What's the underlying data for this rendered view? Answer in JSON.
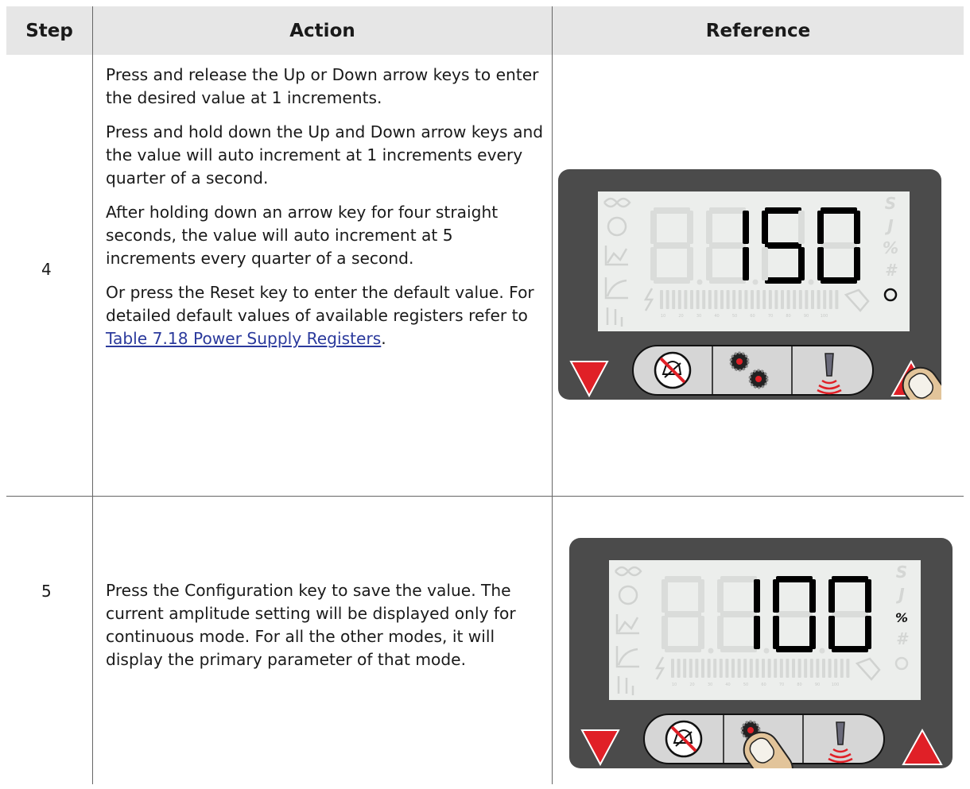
{
  "table": {
    "headers": {
      "step": "Step",
      "action": "Action",
      "reference": "Reference"
    },
    "rows": [
      {
        "step": "4",
        "paragraphs": [
          "Press and release the Up or Down arrow keys to enter the desired value at 1 increments.",
          "Press and hold down the Up and Down arrow keys and the value will auto increment at 1 increments every quarter of a second.",
          "After holding down an arrow key for four straight seconds, the value will auto increment at 5 increments every quarter of a second."
        ],
        "last_paragraph": {
          "text_before": "Or press the Reset key to enter the default value. For detailed default values of available registers refer to ",
          "link_text": "Table 7.18 Power Supply Registers",
          "text_after": "."
        },
        "display": {
          "value": "150",
          "active_unit": "none",
          "indicator": "O",
          "finger_on": "up-arrow-key"
        }
      },
      {
        "step": "5",
        "paragraphs": [
          "Press the Configuration key to save the value. The current amplitude setting will be displayed only for continuous mode. For all the other modes, it will display the primary parameter of that mode."
        ],
        "display": {
          "value": "100",
          "active_unit": "%",
          "indicator": "",
          "finger_on": "configuration-key"
        }
      }
    ]
  },
  "panel_labels": {
    "units": [
      "S",
      "J",
      "%",
      "#"
    ],
    "bar_scale": [
      "10",
      "20",
      "30",
      "40",
      "50",
      "60",
      "70",
      "80",
      "90",
      "100"
    ]
  },
  "colors": {
    "header_bg": "#e6e6e6",
    "panel_body": "#4b4b4b",
    "lcd_bg": "#eceeec",
    "segment_on": "#000000",
    "segment_off": "#dadcda",
    "arrow_red": "#e02027",
    "link": "#2b3a9c"
  }
}
